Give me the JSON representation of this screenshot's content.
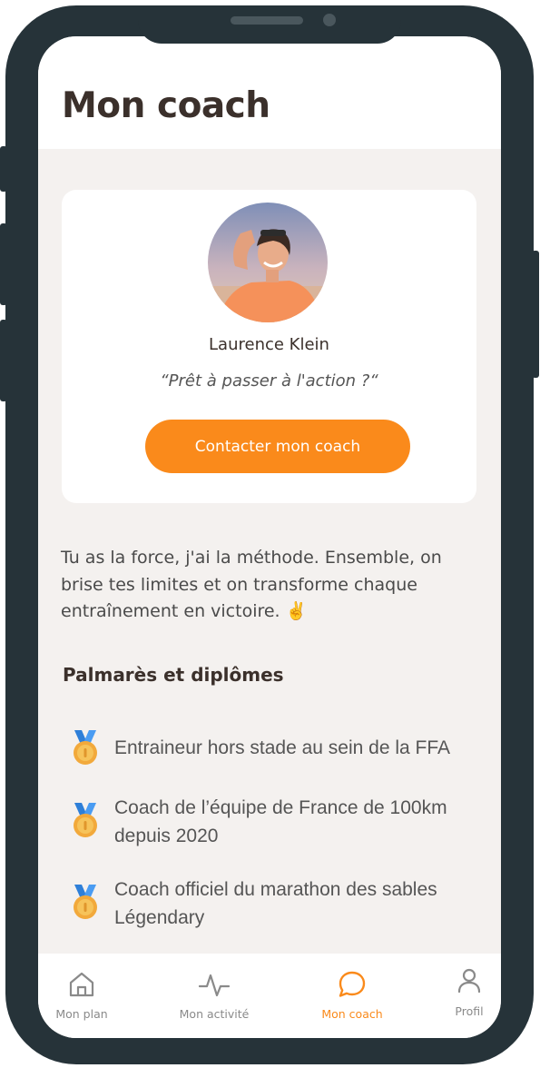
{
  "header": {
    "title": "Mon coach"
  },
  "coach": {
    "name": "Laurence Klein",
    "quote": "“Prêt à passer à l'action ?“",
    "contact_label": "Contacter mon coach",
    "bio": "Tu as la force, j'ai la méthode. Ensemble, on brise tes limites et on transforme chaque entraînement en victoire. ✌️"
  },
  "awards": {
    "title": "Palmarès et diplômes",
    "items": [
      {
        "text": "Entraineur hors stade au sein de la FFA",
        "icon": "medal-icon"
      },
      {
        "text": "Coach de l’équipe de France de 100km depuis 2020",
        "icon": "medal-icon"
      },
      {
        "text": "Coach officiel du marathon des sables Légendary",
        "icon": "medal-icon"
      }
    ]
  },
  "tabs": [
    {
      "label": "Mon plan",
      "icon": "home-icon"
    },
    {
      "label": "Mon activité",
      "icon": "activity-icon"
    },
    {
      "label": "Mon coach",
      "icon": "chat-bubble-icon",
      "active": true
    },
    {
      "label": "Profil",
      "icon": "user-icon"
    }
  ],
  "colors": {
    "accent": "#fa8a1b",
    "phone_frame": "#263339",
    "background": "#f4f1ef",
    "text_dark": "#3b302b"
  }
}
